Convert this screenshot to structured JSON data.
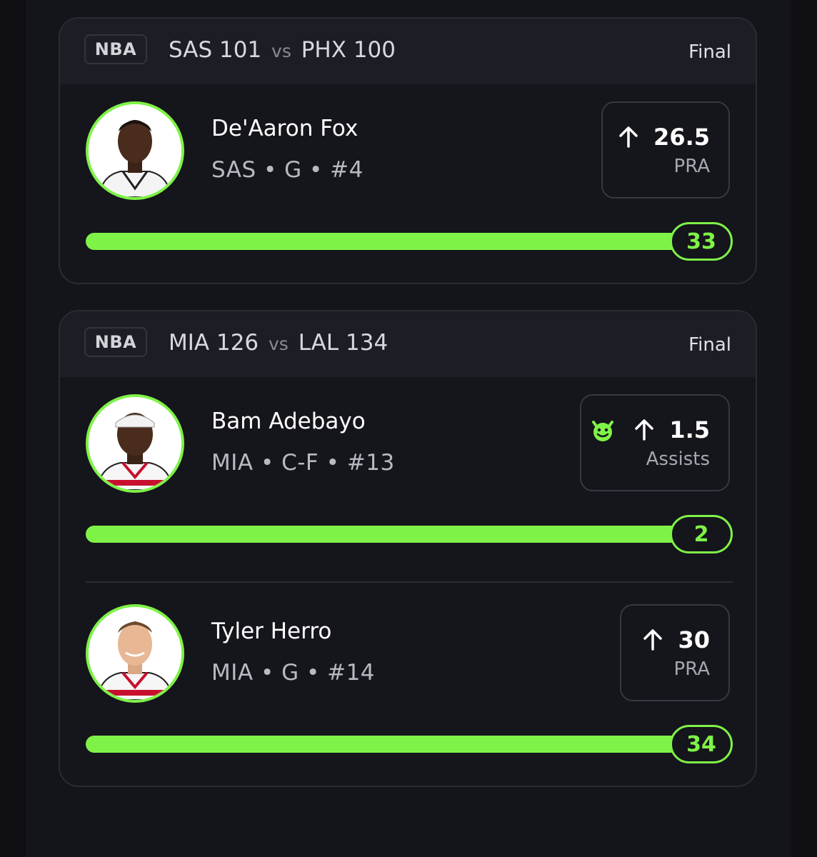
{
  "colors": {
    "accent": "#7ff247",
    "background": "#0e0e13",
    "card": "#15151c",
    "header": "#1d1d25"
  },
  "games": [
    {
      "league": "NBA",
      "away_team": "SAS",
      "away_score": "101",
      "vs_text": "vs",
      "home_team": "PHX",
      "home_score": "100",
      "status": "Final",
      "picks": [
        {
          "name": "De'Aaron Fox",
          "meta": "SAS • G • #4",
          "direction_icon": "arrow-up-icon",
          "line": "26.5",
          "stat": "PRA",
          "result": "33",
          "progress": 1.0,
          "jersey_color": "#ffffff"
        }
      ]
    },
    {
      "league": "NBA",
      "away_team": "MIA",
      "away_score": "126",
      "vs_text": "vs",
      "home_team": "LAL",
      "home_score": "134",
      "status": "Final",
      "picks": [
        {
          "name": "Bam Adebayo",
          "meta": "MIA • C-F • #13",
          "badge_icon": "demon-icon",
          "direction_icon": "arrow-up-icon",
          "line": "1.5",
          "stat": "Assists",
          "result": "2",
          "progress": 1.0,
          "jersey_color": "#ffffff"
        },
        {
          "name": "Tyler Herro",
          "meta": "MIA • G • #14",
          "direction_icon": "arrow-up-icon",
          "line": "30",
          "stat": "PRA",
          "result": "34",
          "progress": 1.0,
          "jersey_color": "#ffffff"
        }
      ]
    }
  ]
}
